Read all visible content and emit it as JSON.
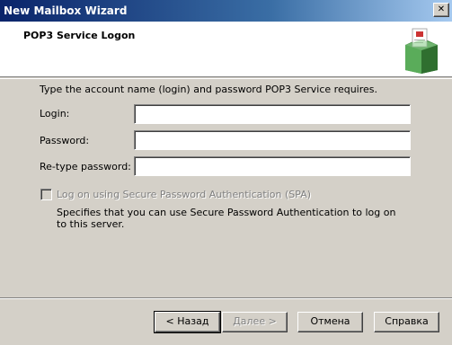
{
  "window": {
    "title": "New Mailbox Wizard",
    "close_glyph": "✕"
  },
  "header": {
    "title": "POP3 Service Logon",
    "icon": "mailbox-icon"
  },
  "form": {
    "instruction": "Type the account name (login) and password POP3 Service requires.",
    "login_label": "Login:",
    "login_value": "",
    "password_label": "Password:",
    "password_value": "",
    "retype_label": "Re-type password:",
    "retype_value": ""
  },
  "spa": {
    "checkbox_label": "Log on using Secure Password Authentication (SPA)",
    "checked": false,
    "enabled": false,
    "description": "Specifies that you can use Secure Password Authentication to log on to this server."
  },
  "buttons": {
    "back": "< Назад",
    "next": "Далее >",
    "cancel": "Отмена",
    "help": "Справка"
  },
  "colors": {
    "title_start": "#0a246a",
    "title_end": "#a6caf0",
    "face": "#d4d0c8",
    "mailbox_green": "#4a9b4a"
  }
}
